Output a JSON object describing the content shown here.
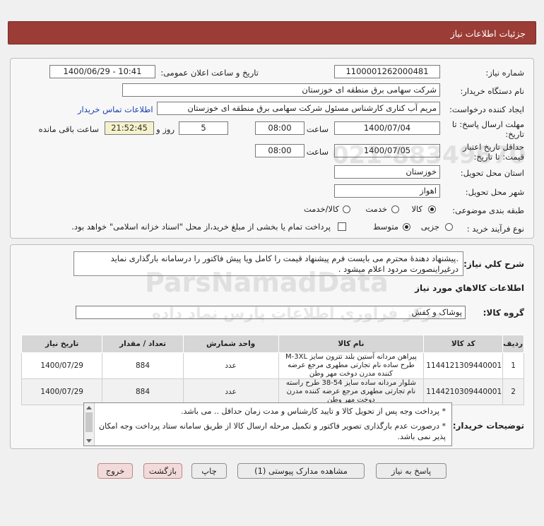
{
  "header": {
    "title": "جزئیات اطلاعات نیاز"
  },
  "form": {
    "need_number_label": "شماره نیاز:",
    "need_number": "1100001262000481",
    "announce_label": "تاریخ و ساعت اعلان عمومی:",
    "announce_value": "1400/06/29 - 10:41",
    "buyer_org_label": "نام دستگاه خریدار:",
    "buyer_org": "شرکت سهامی برق منطقه ای خوزستان",
    "creator_label": "ایجاد کننده درخواست:",
    "creator": "مریم آب کناری کارشناس مسئول شرکت سهامی برق منطقه ای خوزستان",
    "contact_link": "اطلاعات تماس خریدار",
    "deadline_label_1": "مهلت ارسال پاسخ: تا",
    "deadline_label_2": "تاریخ:",
    "deadline_date": "1400/07/04",
    "time_word": "ساعت",
    "deadline_time": "08:00",
    "days_value": "5",
    "days_word": "روز و",
    "remaining_time": "21:52:45",
    "remaining_label": "ساعت باقی مانده",
    "validity_label_1": "حداقل تاریخ اعتبار",
    "validity_label_2": "قیمت: تا تاریخ:",
    "validity_date": "1400/07/05",
    "validity_time": "08:00",
    "province_label": "استان محل تحویل:",
    "province": "خوزستان",
    "city_label": "شهر محل تحویل:",
    "city": "اهواز",
    "category_label": "طبقه بندی موضوعی:",
    "category_options": [
      "کالا",
      "خدمت",
      "کالا/خدمت"
    ],
    "category_selected": "کالا",
    "process_label": "نوع فرآیند خرید :",
    "process_options": [
      "جزیی",
      "متوسط"
    ],
    "process_selected": "متوسط",
    "payment_note": "پرداخت تمام یا بخشی از مبلغ خرید،از محل \"اسناد خزانه اسلامی\" خواهد بود."
  },
  "description": {
    "label": "شرح کلي نياز:",
    "text": ".پیشنهاد دهندۀ محترم می بایست فرم پیشنهاد قیمت را کامل ویا پیش فاکتور را درسامانه بارگذاری نماید درغیراینصورت مردود اعلام میشود ."
  },
  "goods": {
    "section_title": "اطلاعات کالاهاي مورد نياز",
    "group_label": "گروه کالا:",
    "group_value": "پوشاک و کفش",
    "columns": [
      "ردیف",
      "کد کالا",
      "نام کالا",
      "واحد شمارش",
      "تعداد / مقدار",
      "تاریخ نیاز"
    ],
    "rows": [
      {
        "index": "1",
        "code": "1144121309440001",
        "name": "پیراهن مردانه آستین بلند تترون سایز M-3XL طرح ساده نام تجارتی مطهری مرجع عرضه کننده مدرن دوخت مهر وطن",
        "unit": "عدد",
        "qty": "884",
        "date": "1400/07/29"
      },
      {
        "index": "2",
        "code": "1144210309440001",
        "name": "شلوار مردانه ساده سایز 54-38 طرح راسته نام تجارتی مطهری مرجع عرضه کننده مدرن دوخت مهر وطن",
        "unit": "عدد",
        "qty": "884",
        "date": "1400/07/29"
      }
    ]
  },
  "buyer_notes": {
    "label": "توضیحات خریدار:",
    "lines": [
      "* پرداخت وجه پس از تحویل کالا و تایید کارشناس و مدت زمان حداقل ..  می باشد.",
      "* درصورت عدم بارگذاری تصویر فاکتور و تکمیل مرحله ارسال کالا از طریق سامانه ستاد پرداخت وجه امکان پذیر نمی         باشد."
    ]
  },
  "buttons": {
    "reply": "پاسخ به نیاز",
    "attachments": "مشاهده مدارک پیوستی (1)",
    "print": "چاپ",
    "back": "بازگشت",
    "exit": "خروج"
  },
  "watermark": {
    "brand": "ParsNamadData",
    "tagline": "مرکز فراوری اطلاعات پارس نماد داده",
    "phone": "021-88349670"
  }
}
